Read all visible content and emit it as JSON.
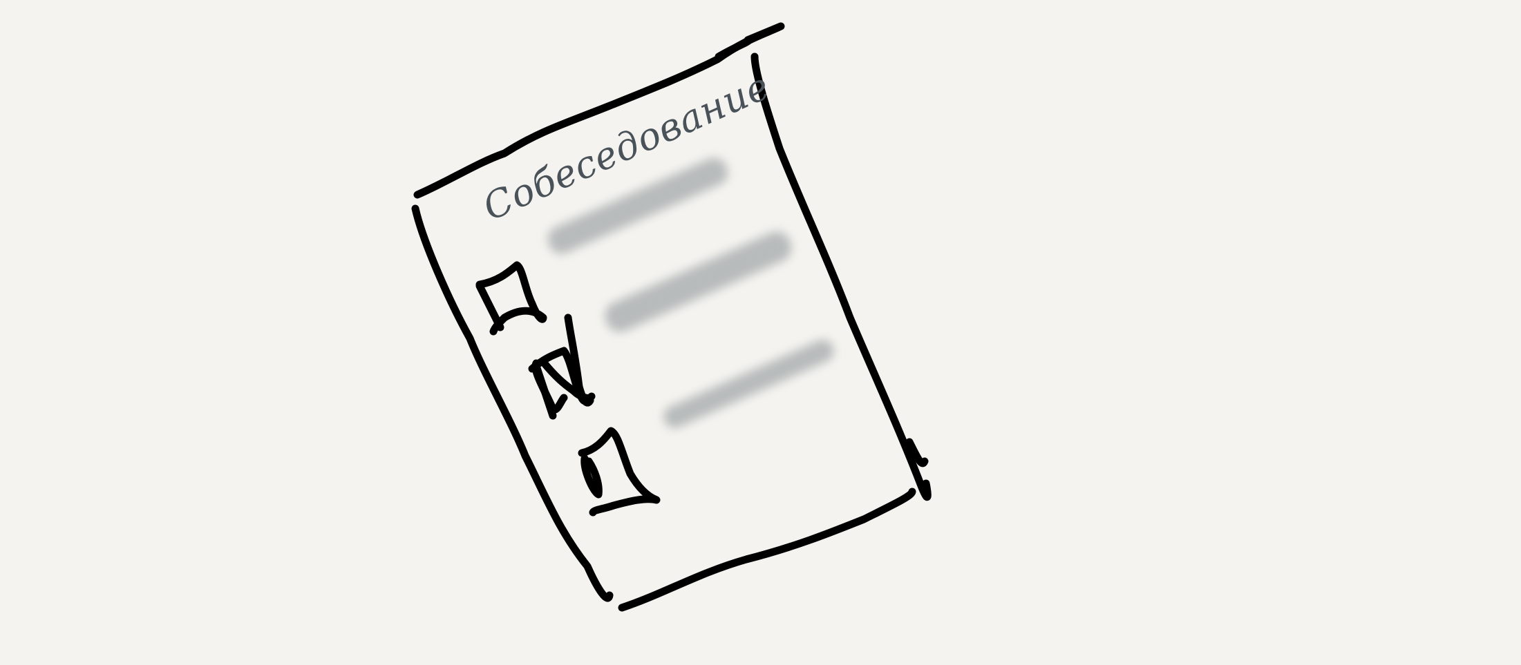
{
  "sketch": {
    "title": "Собеседование",
    "checklist": {
      "items": [
        {
          "checked": false
        },
        {
          "checked": true
        },
        {
          "checked": false
        }
      ]
    }
  },
  "colors": {
    "background": "#f4f3ef",
    "ink": "#000000",
    "title_ink": "#4a5259",
    "blurred_text": "#b8bbbc"
  }
}
